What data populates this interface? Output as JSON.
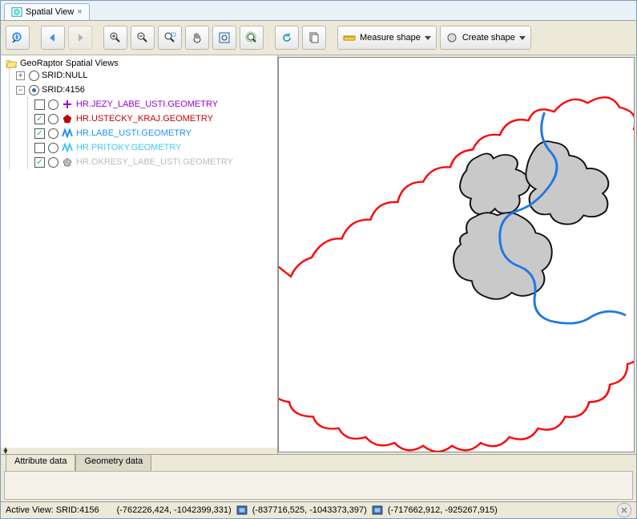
{
  "tab": {
    "title": "Spatial View"
  },
  "toolbar": {
    "measure_label": "Measure shape",
    "create_label": "Create shape"
  },
  "tree": {
    "root": "GeoRaptor Spatial Views",
    "srid_null_label": "SRID:NULL",
    "srid_4156_label": "SRID:4156",
    "layers": [
      {
        "checked": false,
        "selected": false,
        "label": "HR.JEZY_LABE_USTI.GEOMETRY",
        "color": "#9400d3",
        "symbol": "plus"
      },
      {
        "checked": true,
        "selected": false,
        "label": "HR.USTECKY_KRAJ.GEOMETRY",
        "color": "#cc0000",
        "symbol": "poly"
      },
      {
        "checked": true,
        "selected": false,
        "label": "HR.LABE_USTI.GEOMETRY",
        "color": "#1e90ff",
        "symbol": "zig"
      },
      {
        "checked": false,
        "selected": false,
        "label": "HR.PRITOKY.GEOMETRY",
        "color": "#40c8ff",
        "symbol": "zig"
      },
      {
        "checked": true,
        "selected": false,
        "label": "HR.OKRESY_LABE_USTI.GEOMETRY",
        "color": "#bbbbbb",
        "symbol": "poly"
      }
    ]
  },
  "lower_tabs": {
    "attribute": "Attribute data",
    "geometry": "Geometry data"
  },
  "status": {
    "active_view": "Active View: SRID:4156",
    "coord1": "(-762226,424, -1042399,331)",
    "coord2": "(-837716,525, -1043373,397)",
    "coord3": "(-717662,912, -925267,915)"
  },
  "colors": {
    "accent": "#3b6ea5"
  }
}
